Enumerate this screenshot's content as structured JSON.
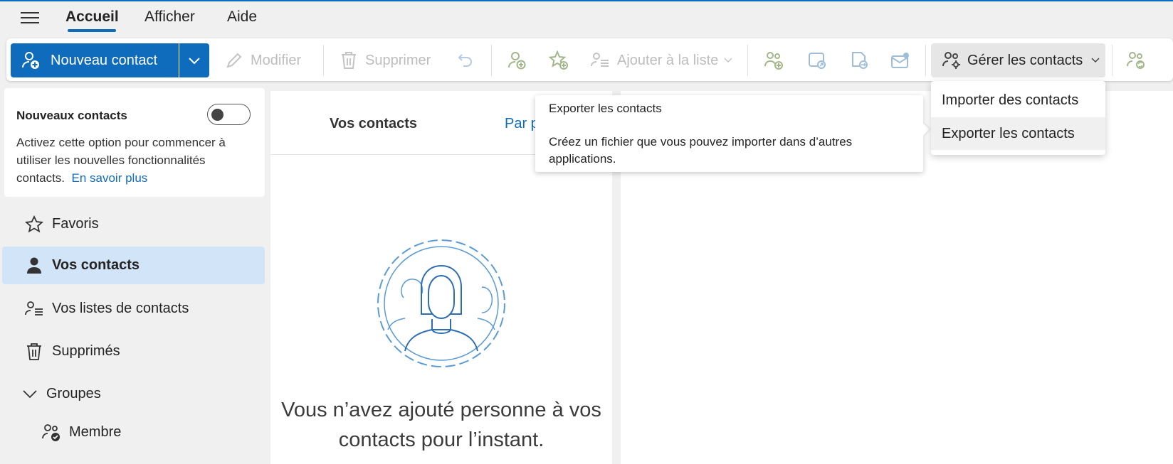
{
  "menubar": {
    "tabs": [
      {
        "label": "Accueil",
        "active": true
      },
      {
        "label": "Afficher",
        "active": false
      },
      {
        "label": "Aide",
        "active": false
      }
    ]
  },
  "ribbon": {
    "new_contact": "Nouveau contact",
    "edit": "Modifier",
    "delete": "Supprimer",
    "add_to_list": "Ajouter à la liste",
    "manage_contacts": "Gérer les contacts"
  },
  "sidebar": {
    "promo": {
      "title": "Nouveaux contacts",
      "text": "Activez cette option pour commencer à utiliser les nouvelles fonctionnalités contacts.",
      "link": "En savoir plus",
      "toggle_on": false
    },
    "items": [
      {
        "label": "Favoris",
        "icon": "star-icon",
        "selected": false
      },
      {
        "label": "Vos contacts",
        "icon": "person-icon",
        "selected": true
      },
      {
        "label": "Vos listes de contacts",
        "icon": "contact-list-icon",
        "selected": false
      },
      {
        "label": "Supprimés",
        "icon": "trash-icon",
        "selected": false
      }
    ],
    "groups_label": "Groupes",
    "member_label": "Membre"
  },
  "main": {
    "tabs": [
      "Vos contacts",
      "Par p"
    ],
    "empty_message": "Vous n’avez ajouté personne à vos contacts pour l’instant."
  },
  "tooltip": {
    "title": "Exporter les contacts",
    "description": "Créez un fichier que vous pouvez importer dans d’autres applications."
  },
  "manage_menu": {
    "items": [
      "Importer des contacts",
      "Exporter les contacts"
    ]
  },
  "colors": {
    "accent": "#0f6cbd",
    "selected_bg": "#d2e4f8",
    "green_icon": "#8aa86a"
  }
}
